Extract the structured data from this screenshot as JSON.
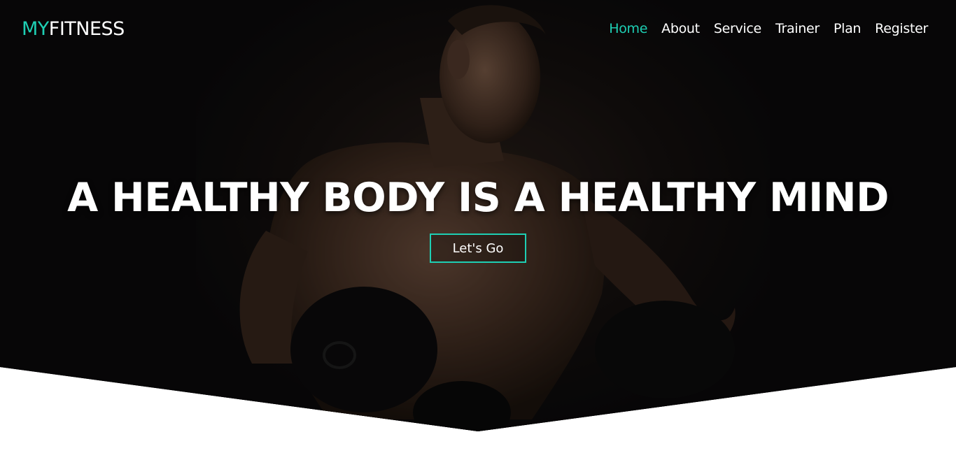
{
  "brand": {
    "prefix": "MY",
    "suffix": "FITNESS"
  },
  "nav": {
    "items": [
      {
        "label": "Home",
        "active": true
      },
      {
        "label": "About"
      },
      {
        "label": "Service"
      },
      {
        "label": "Trainer"
      },
      {
        "label": "Plan"
      },
      {
        "label": "Register"
      }
    ]
  },
  "hero": {
    "headline": "A HEALTHY BODY IS A HEALTHY MIND",
    "cta_label": "Let's Go"
  },
  "colors": {
    "accent": "#1ecfb4",
    "background": "#0c0b0c",
    "text": "#ffffff"
  }
}
